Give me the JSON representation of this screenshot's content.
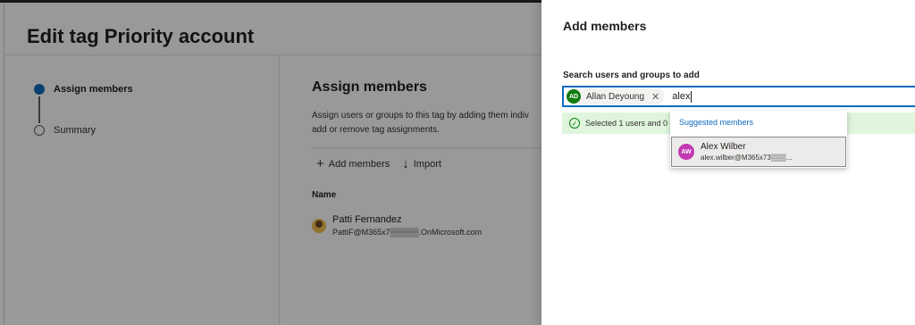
{
  "wizard": {
    "title": "Edit tag Priority account",
    "steps": [
      {
        "label": "Assign members",
        "state": "current"
      },
      {
        "label": "Summary",
        "state": "pending"
      }
    ]
  },
  "section": {
    "title": "Assign members",
    "description_line1": "Assign users or groups to this tag by adding them indiv",
    "description_line2": "add or remove tag assignments.",
    "actions": {
      "add_label": "Add members",
      "import_label": "Import"
    },
    "column_name": "Name",
    "members": [
      {
        "name": "Patti Fernandez",
        "email": "PattiF@M365x7▒▒▒▒▒.OnMicrosoft.com"
      }
    ]
  },
  "flyout": {
    "title": "Add members",
    "search_label": "Search users and groups to add",
    "selected_pill": {
      "initials": "AD",
      "name": "Allan Deyoung",
      "color": "#107c10"
    },
    "search_text": "alex",
    "info_text": "Selected 1 users and 0 g",
    "suggestions": {
      "header": "Suggested members",
      "items": [
        {
          "initials": "AW",
          "name": "Alex Wilber",
          "email": "alex.wilber@M365x73▒▒▒...",
          "color": "#c239b3"
        }
      ]
    }
  },
  "colors": {
    "accent": "#0f6cbd",
    "success_bg": "#dff6dd",
    "success": "#107c10"
  }
}
